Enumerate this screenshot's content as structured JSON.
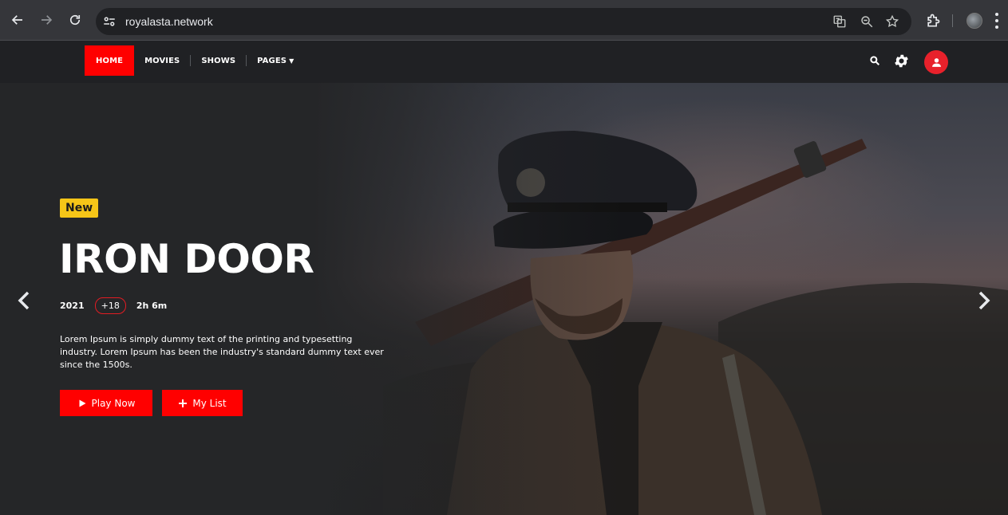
{
  "browser": {
    "url": "royalasta.network",
    "icons": [
      "back-icon",
      "forward-icon",
      "reload-icon",
      "site-info-icon",
      "translate-icon",
      "zoom-icon",
      "star-icon",
      "extensions-icon",
      "profile-avatar",
      "menu-icon"
    ]
  },
  "nav": {
    "items": [
      {
        "label": "HOME",
        "active": true
      },
      {
        "label": "MOVIES",
        "active": false
      },
      {
        "label": "SHOWS",
        "active": false
      },
      {
        "label": "PAGES",
        "active": false
      }
    ],
    "accent_color": "#ff0000"
  },
  "hero": {
    "badge": "New",
    "title": "IRON DOOR",
    "year": "2021",
    "rating": "+18",
    "duration": "2h 6m",
    "description": "Lorem Ipsum is simply dummy text of the printing and typesetting industry. Lorem Ipsum has been the industry's standard dummy text ever since the 1500s.",
    "play_label": "Play Now",
    "list_label": "My List"
  },
  "colors": {
    "badge_yellow": "#f5c518",
    "button_red": "#ff0000",
    "user_red": "#e8212b"
  }
}
